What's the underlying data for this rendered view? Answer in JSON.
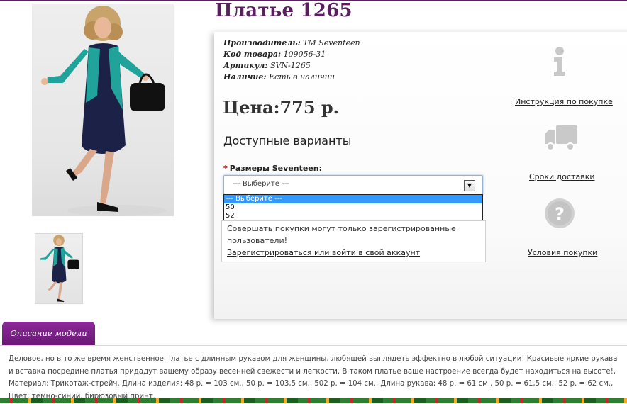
{
  "product": {
    "title": "Платье 1265",
    "specs": [
      {
        "label": "Производитель:",
        "value": "TM Seventeen"
      },
      {
        "label": "Код товара:",
        "value": "109056-31"
      },
      {
        "label": "Артикул:",
        "value": "SVN-1265"
      },
      {
        "label": "Наличие:",
        "value": "Есть в наличии"
      }
    ],
    "price": "Цена:775 р."
  },
  "variants": {
    "heading": "Доступные варианты",
    "required_mark": "*",
    "size_label": "Размеры Seventeen:",
    "select_value": "--- Выберите ---",
    "options": [
      "--- Выберите ---",
      "50",
      "52"
    ]
  },
  "notice": {
    "message": "Совершать покупки могут только зарегистрированные пользователи!",
    "link": "Зарегистрироваться или войти в свой аккаунт"
  },
  "side_links": {
    "instruction": "Инструкция по покупке",
    "delivery": "Сроки доставки",
    "terms": "Условия покупки"
  },
  "description": {
    "tab": "Описание модели",
    "text": "Деловое, но в то же время женственное платье с длинным рукавом для женщины, любящей выглядеть эффектно в любой ситуации! Красивые яркие рукава и вставка посредине платья придадут вашему образу весенней свежести и легкости. В таком платье ваше настроение всегда будет находиться на высоте!, Материал: Трикотаж-стрейч, Длина изделия: 48 р. = 103 см., 50 р. = 103,5 см., 502 р. = 104 см., Длина рукава: 48 р. = 61 см., 50 р. = 61,5 см., 52 р. = 62 см., Цвет: темно-синий, бирюзовый принт."
  },
  "colors": {
    "accent": "#5a1f5e",
    "tab": "#7a1f88",
    "selection": "#3399ff"
  },
  "icons": {
    "info": "info-icon",
    "delivery": "truck-icon",
    "terms": "question-icon"
  }
}
